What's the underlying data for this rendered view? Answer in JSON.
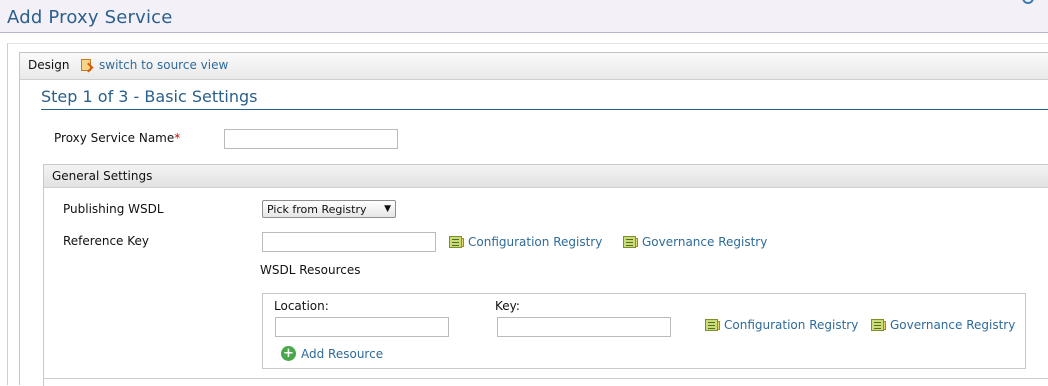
{
  "page": {
    "title": "Add Proxy Service"
  },
  "design_bar": {
    "design_label": "Design",
    "switch_link": "switch to source view"
  },
  "step": {
    "title": "Step 1 of 3 - Basic Settings"
  },
  "proxy_name": {
    "label": "Proxy Service Name",
    "required_mark": "*",
    "value": ""
  },
  "general_settings": {
    "title": "General Settings",
    "publishing_wsdl": {
      "label": "Publishing WSDL",
      "selected": "Pick from Registry"
    },
    "reference_key": {
      "label": "Reference Key",
      "value": ""
    },
    "config_registry": "Configuration Registry",
    "gov_registry": "Governance Registry",
    "wsdl_resources": {
      "title": "WSDL Resources",
      "location_label": "Location:",
      "key_label": "Key:",
      "location_value": "",
      "key_value": "",
      "add_resource": "Add Resource"
    }
  },
  "icons": {
    "switch": "switch-view-icon",
    "registry": "registry-browser-icon",
    "add": "add-circle-icon"
  },
  "colors": {
    "link": "#2f6b9a",
    "title": "#2b5f8c",
    "required": "#dd0000"
  }
}
